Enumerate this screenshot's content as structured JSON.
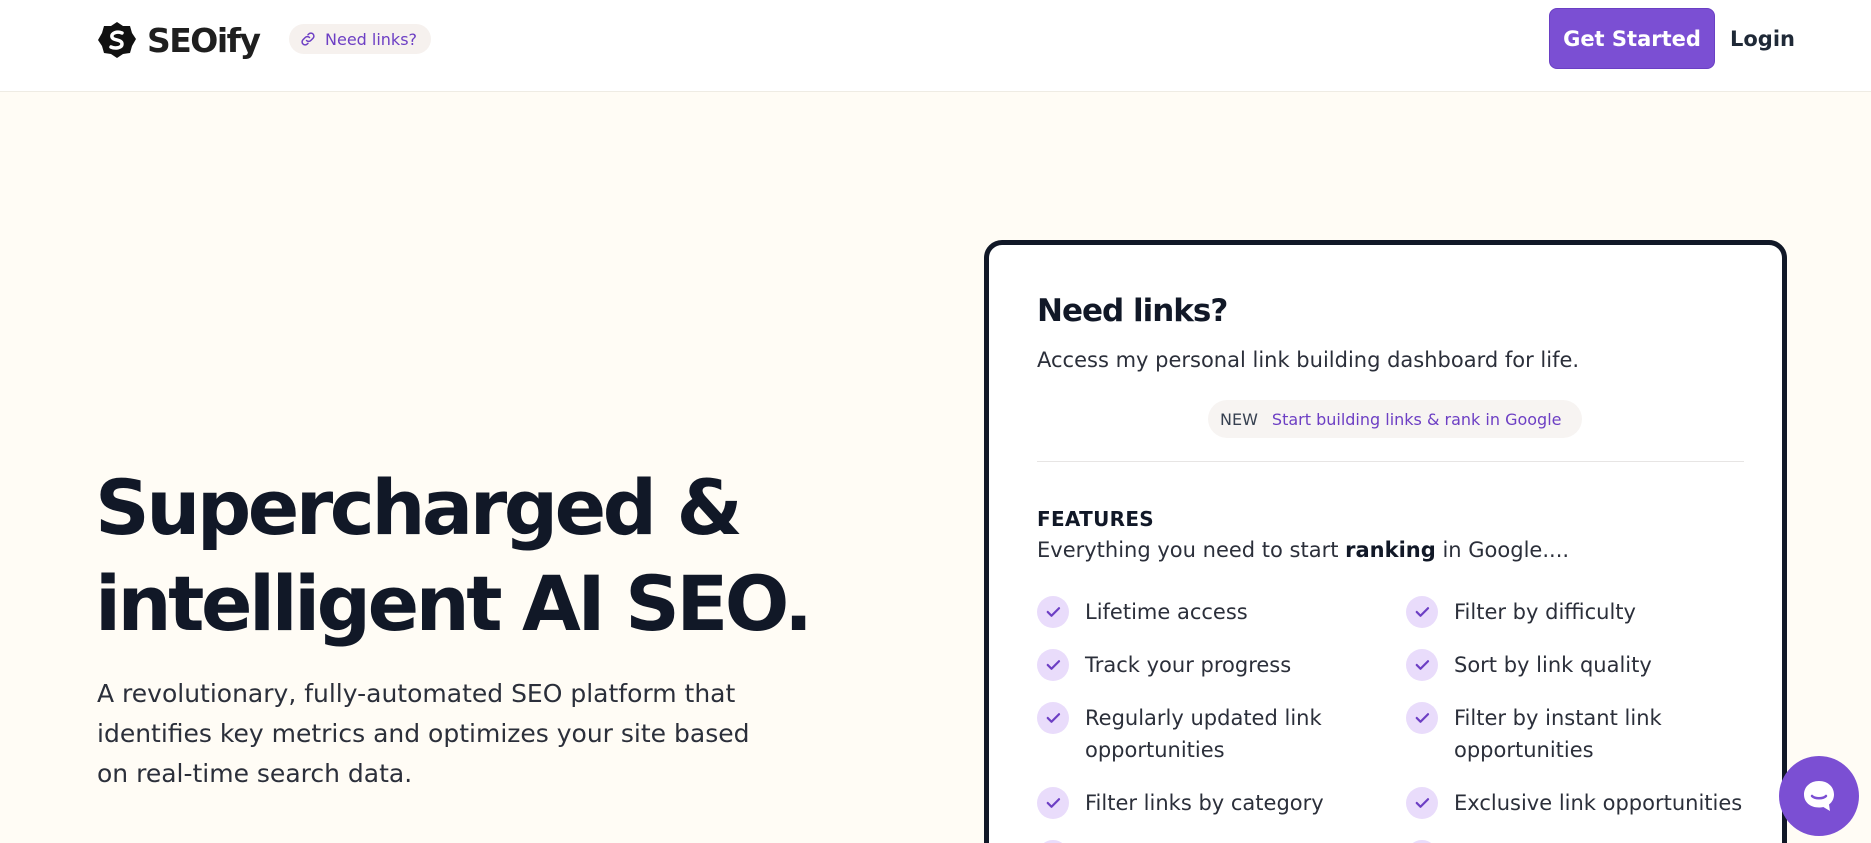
{
  "header": {
    "brand": "SEOify",
    "pill_label": "Need links?",
    "cta_label": "Get Started",
    "login_label": "Login"
  },
  "hero": {
    "title_line1": "Supercharged &",
    "title_line2": "intelligent AI SEO.",
    "subtitle": "A revolutionary, fully-automated SEO platform that identifies key metrics and optimizes your site based on real-time search data."
  },
  "card": {
    "title": "Need links?",
    "description": "Access my personal link building dashboard for life.",
    "badge_new": "NEW",
    "badge_text": "Start building links & rank in Google",
    "features_heading": "FEATURES",
    "features_sub_prefix": "Everything you need to start",
    "features_sub_bold": "ranking",
    "features_sub_suffix": "in Google....",
    "features_left": [
      "Lifetime access",
      "Track your progress",
      "Regularly updated link opportunities",
      "Filter links by category"
    ],
    "features_right": [
      "Filter by difficulty",
      "Sort by link quality",
      "Filter by instant link opportunities",
      "Exclusive link opportunities"
    ]
  },
  "colors": {
    "accent": "#7b4fd3",
    "background": "#fffcf5",
    "check_bg": "#e9dcfb"
  },
  "icons": {
    "logo": "seoify-logo-icon",
    "pill": "link-icon",
    "check": "check-icon",
    "chat": "chat-bubble-icon"
  }
}
